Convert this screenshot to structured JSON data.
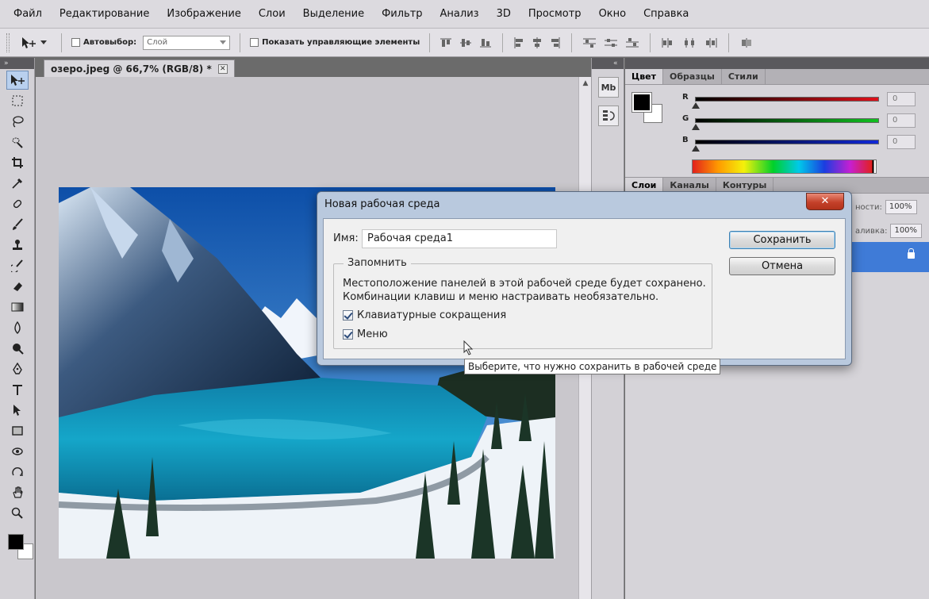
{
  "menu": [
    "Файл",
    "Редактирование",
    "Изображение",
    "Слои",
    "Выделение",
    "Фильтр",
    "Анализ",
    "3D",
    "Просмотр",
    "Окно",
    "Справка"
  ],
  "options": {
    "autoselect_label": "Автовыбор:",
    "autoselect_value": "Слой",
    "show_controls_label": "Показать управляющие элементы"
  },
  "document": {
    "tab_title": "озеро.jpeg @ 66,7% (RGB/8) *",
    "close_glyph": "✕"
  },
  "strip": {
    "mb_label": "Mb"
  },
  "color_panel": {
    "tabs": [
      "Цвет",
      "Образцы",
      "Стили"
    ],
    "r_label": "R",
    "g_label": "G",
    "b_label": "B",
    "r_value": "0",
    "g_value": "0",
    "b_value": "0",
    "colors": {
      "r": "#e0101a",
      "g": "#10c020",
      "b": "#1028d8"
    }
  },
  "layers_panel": {
    "tabs": [
      "Слои",
      "Каналы",
      "Контуры"
    ],
    "opacity_label": "ности:",
    "opacity_value": "100%",
    "fill_label": "аливка:",
    "fill_value": "100%"
  },
  "dialog": {
    "title": "Новая рабочая среда",
    "close_glyph": "✕",
    "name_label": "Имя:",
    "name_value": "Рабочая среда1",
    "group_title": "Запомнить",
    "group_text_line1": "Местоположение панелей в этой рабочей среде будет сохранено.",
    "group_text_line2": "Комбинации клавиш и меню настраивать необязательно.",
    "shortcuts_label": "Клавиатурные сокращения",
    "shortcuts_checked": true,
    "menus_label": "Меню",
    "menus_checked": true,
    "save_button": "Сохранить",
    "cancel_button": "Отмена"
  },
  "tooltip": "Выберите, что нужно сохранить в рабочей среде"
}
